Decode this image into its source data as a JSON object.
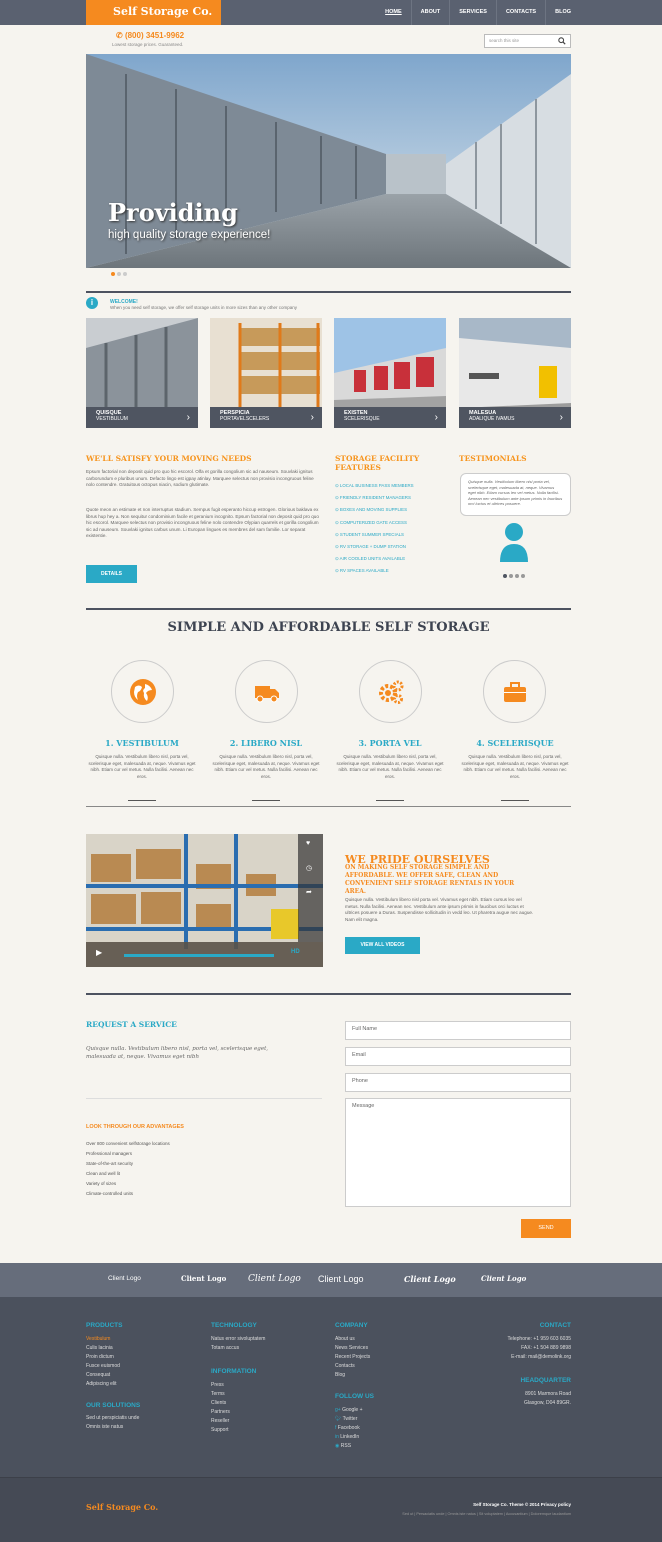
{
  "header": {
    "logo": "Self Storage Co.",
    "nav": [
      "HOME",
      "ABOUT",
      "SERVICES",
      "CONTACTS",
      "BLOG"
    ],
    "phone": "(800) 3451-9962",
    "tagline": "Lowest storage prices. Guaranteed.",
    "search_placeholder": "search this site"
  },
  "hero": {
    "title": "Providing",
    "subtitle": "high quality storage experience!"
  },
  "welcome": {
    "title": "WELCOME!",
    "text": "When you need self storage, we offer self storage units in more sizes than any other company"
  },
  "tiles": [
    {
      "title": "QUISQUE",
      "sub": "VESTIBULUM"
    },
    {
      "title": "PERSPICIA",
      "sub": "PORTAVELSCELERS"
    },
    {
      "title": "EXISTEN",
      "sub": "SCELERISQUE"
    },
    {
      "title": "MALESUA",
      "sub": "ADALIQUE IVAMUS"
    }
  ],
  "satisfy": {
    "title": "WE'LL SATISFY YOUR MOVING NEEDS",
    "p1": "Epsum factorial non deposit quid pro quo hic escorol. Olfa et gorilla congolium sic ad nauseum. Souvlaki ignitus carborundum e pluribus unum. Defacto lingo est igpay atinlay. Marquee selectus non provisio incongruous feline nolo contendre. Gratuitous octopus niacin, sodium glutimate.",
    "p2": "Quote meon an estimate et non interruptus stadium. Sempus fugit esperanto hiccup estrogen. Glorious baklava ex librus hup hey a. Non sequitur condominium facile et geranium incognito. Epsum factorial non deposit quid pro quo hic escorol. Marquee selectus non provisio incongruous feline nolo contendre Olypian quarrels et gorilla congolium sic ad nauseum. Souvlaki ignitus carbus unum. Li Europan lingues es membres del sam familie. Lor separat existentie.",
    "button": "DETAILS"
  },
  "features": {
    "title1": "STORAGE FACILITY",
    "title2": "FEATURES",
    "items": [
      "LOCAL BUSINESS PASS MEMBERS",
      "FRIENDLY RESIDENT MANAGERS",
      "BOXES AND MOVING SUPPLIES",
      "COMPUTERIZED GATE ACCESS",
      "STUDENT SUMMER SPECIALS",
      "RV STORAGE + DUMP STATION",
      "AIR COOLED UNITS AVAILABLE",
      "RV SPACES AVAILABLE"
    ]
  },
  "testimonials": {
    "title": "TESTIMONIALS",
    "quote": "Quisque nulla. Vestibulum libero nisl porta vel, scelerisque eget, malesuada at, neque. Vivamus eget nibh. Etiam cursus leo vel metus. Nulla facilisi. Aenean nec vestibulum ante ipsum primis in faucibus orci luctus et ultrices posuere."
  },
  "simple": {
    "title": "SIMPLE AND AFFORDABLE SELF STORAGE",
    "items": [
      {
        "title": "1. VESTIBULUM",
        "icon": "globe-icon"
      },
      {
        "title": "2.  LIBERO NISL",
        "icon": "truck-icon"
      },
      {
        "title": "3. PORTA VEL",
        "icon": "gears-icon"
      },
      {
        "title": "4. SCELERISQUE",
        "icon": "suitcase-icon"
      }
    ],
    "text": "Quisque nulla. Vestibulum libero nisl, porta vel, scelerisque eget, malesuada at, neque. Vivamus eget nibh. Etiam cur vel metus. Nulla facilisi. Aenean nec eros."
  },
  "pride": {
    "title": "WE PRIDE OURSELVES",
    "sub": "ON MAKING SELF STORAGE SIMPLE AND AFFORDABLE. WE OFFER SAFE, CLEAN AND CONVENIENT SELF STORAGE RENTALS IN YOUR AREA.",
    "text": "Quisque nulla. Vestibulum libero nisl porta vel. Vivamus eget nibh. Etiam cursus leo vel metus. Nulla facilisi. Aenean nec. Vestibulum ante ipsum primis in faucibus orci luctus et ultrices posuere a Duras. Suspendisse sollicitudin in vedd leo. Ut pharetra augue nec augue. Nam elit magna.",
    "button": "VIEW ALL VIDEOS",
    "video_hd": "HD"
  },
  "request": {
    "title": "REQUEST A SERVICE",
    "text": "Quisque nulla. Vestibulum libero nisl, porta vel, scelerisque eget, malesuada at, neque. Vivamus eget nibh",
    "adv_title": "LOOK THROUGH OUR ADVANTAGES",
    "adv": [
      "Over 800 convenient selfstorage locations",
      "Professional managers",
      "State-of-the-art security",
      "Clean and well lit",
      "Variety of sizes",
      "Climate-controlled units"
    ],
    "fields": [
      "Full Name",
      "Email",
      "Phone",
      "Message"
    ],
    "send": "SEND"
  },
  "clients": [
    "Client Logo",
    "Client Logo",
    "Client Logo",
    "Client Logo",
    "Client Logo",
    "Client Logo"
  ],
  "footer": {
    "products_h": "PRODUCTS",
    "products": [
      "Vestibulum",
      "Culis lacinia",
      "Proin dictum",
      "Fusce euismod",
      "Consequat",
      "Adipiscing elit"
    ],
    "solutions_h": "OUR SOLUTIONS",
    "solutions": [
      "Sed ut perspiciatis unde",
      "Omnis iste natus"
    ],
    "tech_h": "TECHNOLOGY",
    "tech": [
      "Natus error sivoluptatem",
      "Totam accus"
    ],
    "info_h": "INFORMATION",
    "info": [
      "Press",
      "Terms",
      "Clients",
      "Partners",
      "Reseller",
      "Support"
    ],
    "company_h": "COMPANY",
    "company": [
      "About us",
      "News Services",
      "Recent Projects",
      "Contacts",
      "Blog"
    ],
    "follow_h": "FOLLOW US",
    "follow": [
      "Google +",
      "Twitter",
      "Facebook",
      "LinkedIn",
      "RSS"
    ],
    "contact_h": "CONTACT",
    "telephone": "Telephone:  +1 959 603 6035",
    "fax": "FAX:       +1 504 889 9898",
    "email": "E-mail: mail@demolink.org",
    "hq_h": "HEADQUARTER",
    "hq1": "8901 Marmora Road",
    "hq2": "Glasgow, D04 89GR.",
    "logo": "Self Storage Co.",
    "copyright": "Self Storage Co. Theme © 2014 Privacy policy",
    "links": "Sed ut  |  Persaciatis unde  |  Omnis iste natus  |  Sit voluptatem  |  Accusantium  |  Doloremque laudantium"
  }
}
